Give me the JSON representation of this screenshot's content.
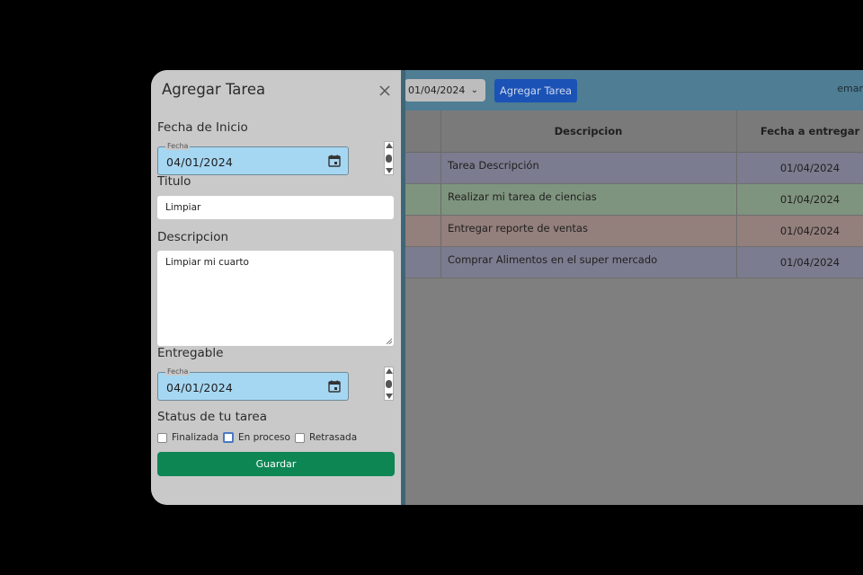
{
  "panel": {
    "title": "Agregar Tarea",
    "start_date_label": "Fecha de Inicio",
    "start_date": {
      "legend": "Fecha",
      "value": "04/01/2024"
    },
    "title_label": "Titulo",
    "title_value": "Limpiar",
    "description_label": "Descripcion",
    "description_value": "Limpiar mi cuarto",
    "deliverable_label": "Entregable",
    "deliverable_date": {
      "legend": "Fecha",
      "value": "04/01/2024"
    },
    "status_label": "Status de tu tarea",
    "status_options": [
      {
        "label": "Finalizada",
        "checked": false
      },
      {
        "label": "En proceso",
        "checked": false,
        "focused": true
      },
      {
        "label": "Retrasada",
        "checked": false
      }
    ],
    "save_label": "Guardar"
  },
  "background": {
    "date_filter": "01/04/2024",
    "add_task_label": "Agregar Tarea",
    "user_label": "emar",
    "columns": [
      "Descripcion",
      "Fecha a entregar"
    ],
    "rows": [
      {
        "description": "Tarea Descripción",
        "due": "01/04/2024",
        "color": "#7c7c90"
      },
      {
        "description": "Realizar mi tarea de ciencias",
        "due": "01/04/2024",
        "color": "#7f947e"
      },
      {
        "description": "Entregar reporte de ventas",
        "due": "01/04/2024",
        "color": "#937f7c"
      },
      {
        "description": "Comprar Alimentos en el super mercado",
        "due": "01/04/2024",
        "color": "#7c7c90"
      }
    ]
  },
  "colors": {
    "save_button": "#0d8654",
    "add_task_button": "#1b52b6",
    "date_field": "#a6d7f2",
    "toolbar": "#4e7d94"
  }
}
